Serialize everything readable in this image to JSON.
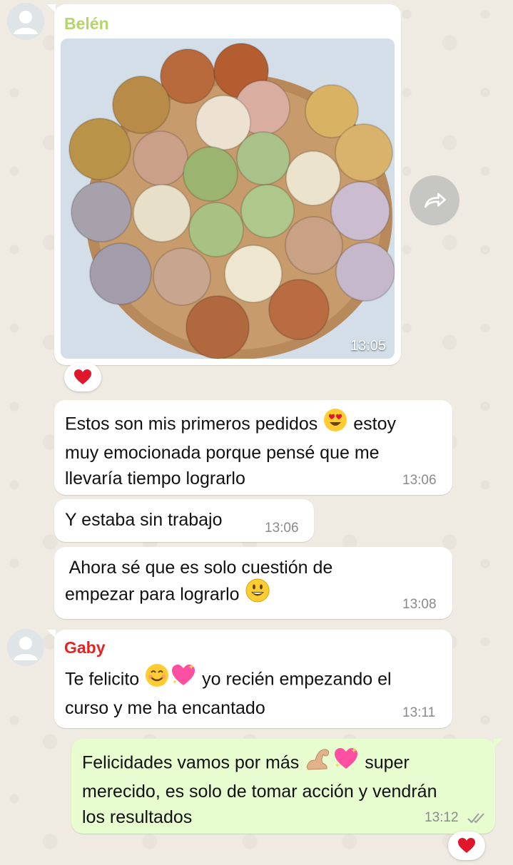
{
  "messages": [
    {
      "type": "image",
      "sender": "Belén",
      "sender_color": "#bada55",
      "time": "13:05",
      "reaction": "❤️",
      "image_description_icon": "photo"
    },
    {
      "type": "text",
      "lines": [
        "Estos son mis primeros pedidos",
        "estoy",
        "muy emocionada porque pensé que me",
        "llevaría tiempo lograrlo"
      ],
      "emoji": "heart-eyes",
      "time": "13:06"
    },
    {
      "type": "text",
      "lines": [
        "Y estaba sin trabajo"
      ],
      "time": "13:06"
    },
    {
      "type": "text",
      "lines": [
        " Ahora sé que es solo cuestión de",
        "empezar para lograrlo"
      ],
      "emoji": "grinning",
      "time": "13:08"
    },
    {
      "type": "text",
      "sender": "Gaby",
      "sender_color": "#e53935",
      "lines": [
        "Te felicito",
        "yo recién empezando el",
        "curso y me ha encantado"
      ],
      "emoji": [
        "smiling",
        "sparkling-heart"
      ],
      "time": "13:11"
    },
    {
      "type": "text",
      "outgoing": true,
      "lines": [
        "Felicidades vamos por más",
        "super",
        "merecido, es solo de tomar acción y vendrán",
        "los resultados"
      ],
      "emoji": [
        "flexed-biceps",
        "sparkling-heart"
      ],
      "time": "13:12",
      "status": "read",
      "reaction": "❤️"
    }
  ],
  "colors": {
    "incoming_bubble": "#ffffff",
    "outgoing_bubble": "#e7fccf",
    "wallpaper": "#efeae2",
    "read_ticks": "#9e9e9e"
  },
  "icons": [
    "avatar-placeholder-icon",
    "forward-icon",
    "heart-reaction-icon",
    "double-check-icon"
  ]
}
